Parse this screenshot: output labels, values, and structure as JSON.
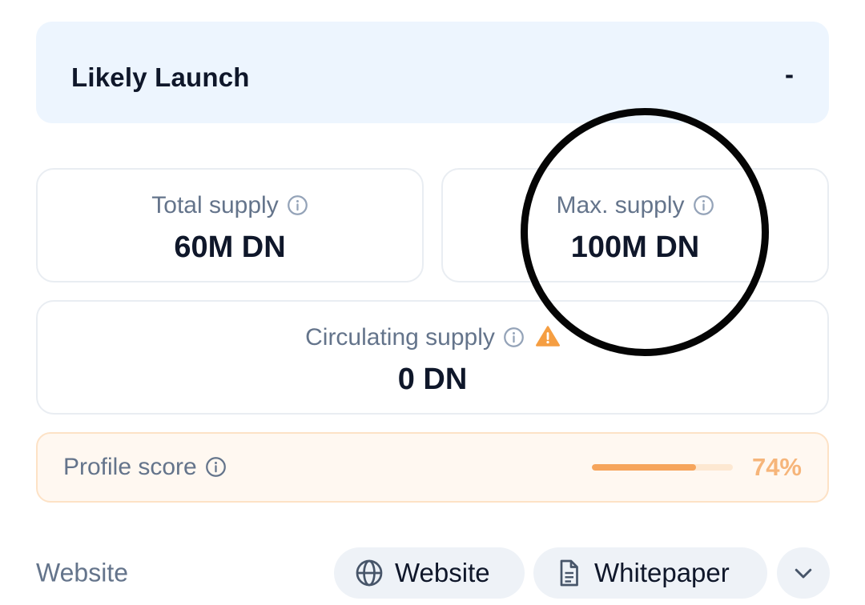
{
  "launch": {
    "label": "Likely Launch",
    "value": "-"
  },
  "supply": {
    "total": {
      "label": "Total supply",
      "value": "60M DN"
    },
    "max": {
      "label": "Max. supply",
      "value": "100M DN"
    },
    "circulating": {
      "label": "Circulating supply",
      "value": "0 DN"
    }
  },
  "profile": {
    "label": "Profile score",
    "score_text": "74%",
    "score_fraction": 0.74
  },
  "links": {
    "label": "Website",
    "website_button": "Website",
    "whitepaper_button": "Whitepaper"
  },
  "colors": {
    "accent_orange": "#f6a55c",
    "launch_bg": "#edf5fe",
    "warning": "#f59e42"
  }
}
